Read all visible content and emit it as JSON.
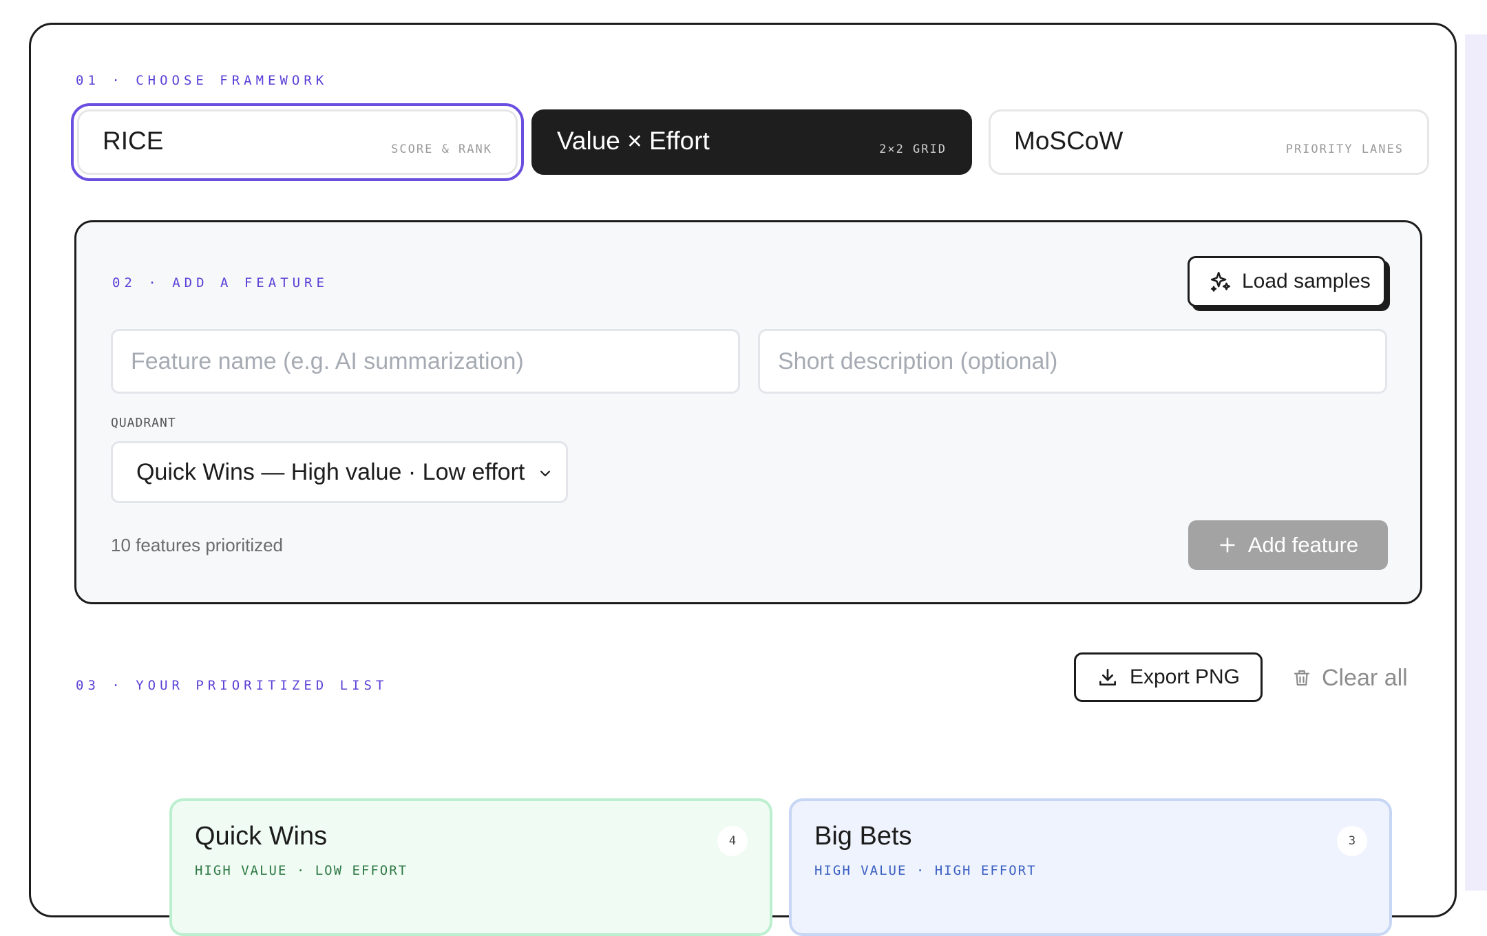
{
  "section1": {
    "label": "01 · CHOOSE FRAMEWORK"
  },
  "frameworks": [
    {
      "name": "RICE",
      "sub": "SCORE & RANK"
    },
    {
      "name": "Value × Effort",
      "sub": "2×2 GRID"
    },
    {
      "name": "MoSCoW",
      "sub": "PRIORITY LANES"
    }
  ],
  "section2": {
    "label": "02 · ADD A FEATURE",
    "load_samples": "Load samples",
    "feature_name_placeholder": "Feature name (e.g. AI summarization)",
    "description_placeholder": "Short description (optional)",
    "quadrant_label": "QUADRANT",
    "quadrant_value": "Quick Wins — High value · Low effort",
    "count_text": "10 features prioritized",
    "add_feature": "Add feature"
  },
  "section3": {
    "label": "03 · YOUR PRIORITIZED LIST",
    "export": "Export PNG",
    "clear": "Clear all"
  },
  "quadrants": [
    {
      "title": "Quick Wins",
      "sub": "HIGH VALUE · LOW EFFORT",
      "count": "4"
    },
    {
      "title": "Big Bets",
      "sub": "HIGH VALUE · HIGH EFFORT",
      "count": "3"
    }
  ],
  "colors": {
    "accent": "#5b3fd6",
    "selected_outline": "#6a4ee0",
    "dark_card": "#1e1e1e"
  }
}
